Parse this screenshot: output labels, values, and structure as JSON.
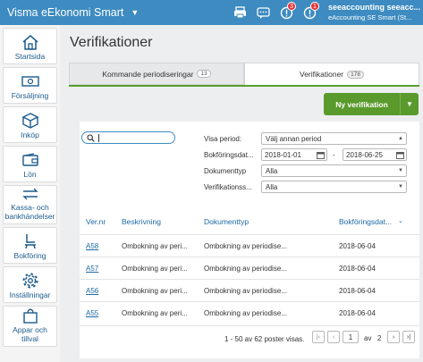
{
  "topbar": {
    "app_name": "Visma eEkonomi Smart",
    "badges": {
      "notifications": "3",
      "alerts": "1"
    },
    "account_name": "seeaccounting seeacc...",
    "account_sub": "eAccounting SE Smart (St..."
  },
  "sidebar": {
    "items": [
      {
        "label": "Startsida",
        "icon": "home-icon"
      },
      {
        "label": "Försäljning",
        "icon": "cash-icon"
      },
      {
        "label": "Inköp",
        "icon": "box-icon"
      },
      {
        "label": "Lön",
        "icon": "wallet-icon"
      },
      {
        "label": "Kassa- och bankhändelser",
        "icon": "transfer-icon"
      },
      {
        "label": "Bokföring",
        "icon": "chair-icon"
      },
      {
        "label": "Inställningar",
        "icon": "gear-icon"
      },
      {
        "label": "Appar och tillval",
        "icon": "bag-icon"
      }
    ]
  },
  "page": {
    "title": "Verifikationer",
    "tabs": [
      {
        "label": "Kommande periodiseringar",
        "count": "13"
      },
      {
        "label": "Verifikationer",
        "count": "178"
      }
    ],
    "new_button": "Ny verifikation"
  },
  "filters": {
    "period_label": "Visa period:",
    "period_value": "Välj annan period",
    "date_label": "Bokföringsdat...",
    "date_from": "2018-01-01",
    "date_sep": "-",
    "date_to": "2018-06-25",
    "doctype_label": "Dokumenttyp",
    "doctype_value": "Alla",
    "series_label": "Verifikationss...",
    "series_value": "Alla"
  },
  "table": {
    "headers": [
      "Ver.nr",
      "Beskrivning",
      "Dokumenttyp",
      "Bokföringsdat..."
    ],
    "rows": [
      {
        "nr": "A58",
        "desc": "Ombokning av peri...",
        "doc": "Ombokning av periodise...",
        "date": "2018-06-04"
      },
      {
        "nr": "A57",
        "desc": "Ombokning av peri...",
        "doc": "Ombokning av periodise...",
        "date": "2018-06-04"
      },
      {
        "nr": "A56",
        "desc": "Ombokning av peri...",
        "doc": "Ombokning av periodise...",
        "date": "2018-06-04"
      },
      {
        "nr": "A55",
        "desc": "Ombokning av peri...",
        "doc": "Ombokning av periodise...",
        "date": "2018-06-04"
      }
    ]
  },
  "pager": {
    "info": "1 - 50 av 62 poster visas.",
    "current": "1",
    "of_label": "av",
    "total": "2"
  },
  "colors": {
    "brand": "#3d8bc0",
    "accent_green": "#5a9a2c",
    "link": "#1c6aa5"
  }
}
